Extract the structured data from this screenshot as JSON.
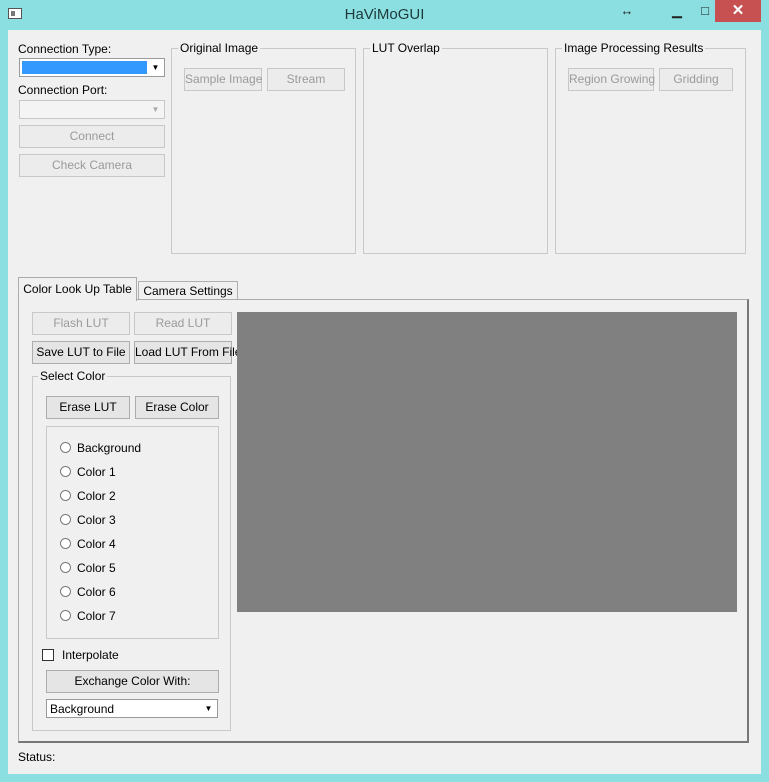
{
  "window": {
    "title": "HaViMoGUI",
    "resize_glyph": "↔",
    "minimize_glyph": "▁",
    "maximize_glyph": "□",
    "close_glyph": "✕"
  },
  "connection": {
    "type_label": "Connection Type:",
    "port_label": "Connection Port:",
    "connect_label": "Connect",
    "check_camera_label": "Check Camera"
  },
  "groups": {
    "original_image": {
      "title": "Original Image",
      "sample_label": "Sample Image",
      "stream_label": "Stream"
    },
    "lut_overlap": {
      "title": "LUT Overlap"
    },
    "processing": {
      "title": "Image Processing Results",
      "region_growing_label": "Region Growing",
      "gridding_label": "Gridding"
    }
  },
  "tabs": [
    {
      "label": "Color Look Up Table"
    },
    {
      "label": "Camera Settings"
    }
  ],
  "lut": {
    "flash_label": "Flash LUT",
    "read_label": "Read LUT",
    "save_label": "Save LUT to File",
    "load_label": "Load LUT From File",
    "select_color_title": "Select Color",
    "erase_lut_label": "Erase LUT",
    "erase_color_label": "Erase Color",
    "colors": [
      "Background",
      "Color 1",
      "Color 2",
      "Color 3",
      "Color 4",
      "Color 5",
      "Color 6",
      "Color 7"
    ],
    "interpolate_label": "Interpolate",
    "exchange_label": "Exchange Color With:",
    "exchange_value": "Background"
  },
  "preview_color": "#808080",
  "selection_color": "#3399ff",
  "status_label": "Status:"
}
